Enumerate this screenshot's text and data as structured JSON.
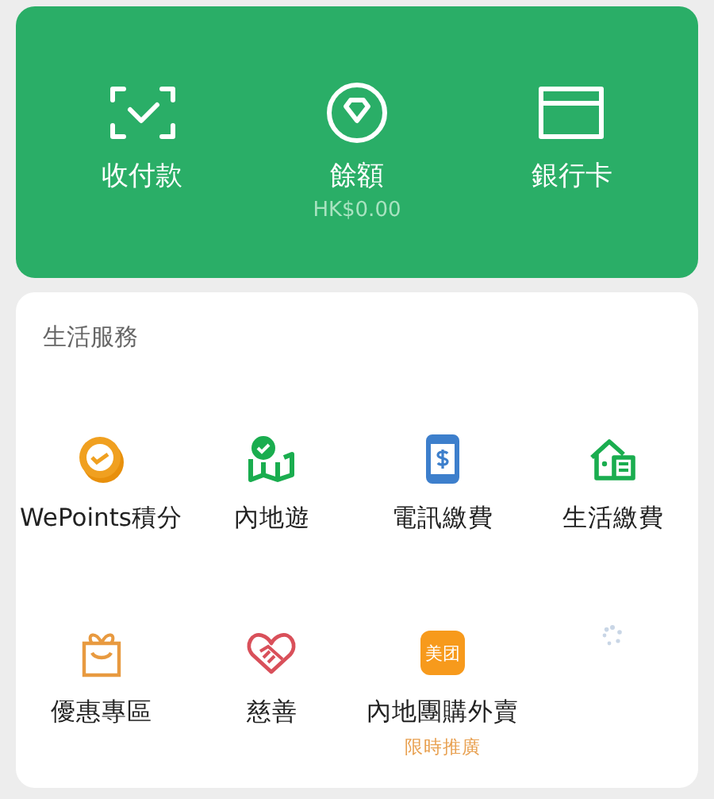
{
  "wallet": {
    "actions": [
      {
        "kind": "scan",
        "label": "收付款"
      },
      {
        "kind": "balance",
        "label": "餘額",
        "sub": "HK$0.00"
      },
      {
        "kind": "card",
        "label": "銀行卡"
      }
    ]
  },
  "services": {
    "title": "生活服務",
    "items": [
      {
        "kind": "coin",
        "label": "WePoints積分"
      },
      {
        "kind": "map",
        "label": "內地遊"
      },
      {
        "kind": "phone",
        "label": "電訊繳費"
      },
      {
        "kind": "house",
        "label": "生活繳費"
      },
      {
        "kind": "gift",
        "label": "優惠專區"
      },
      {
        "kind": "heart",
        "label": "慈善"
      },
      {
        "kind": "tile",
        "label": "內地團購外賣",
        "icon_text": "美团",
        "sub": "限時推廣"
      },
      {
        "kind": "loading"
      }
    ]
  }
}
